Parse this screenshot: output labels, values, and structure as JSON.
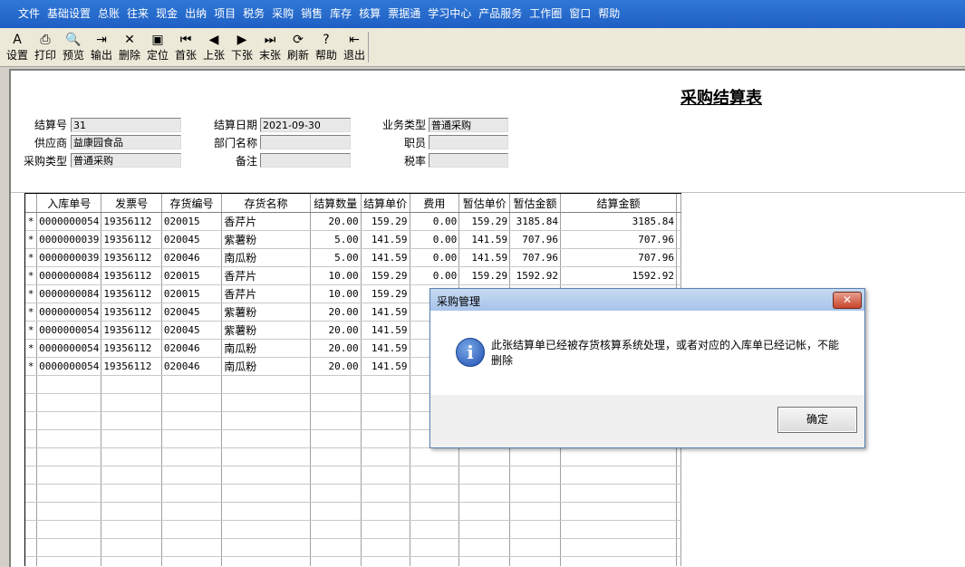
{
  "menu": [
    "文件",
    "基础设置",
    "总账",
    "往来",
    "现金",
    "出纳",
    "项目",
    "税务",
    "采购",
    "销售",
    "库存",
    "核算",
    "票据通",
    "学习中心",
    "产品服务",
    "工作圈",
    "窗口",
    "帮助"
  ],
  "toolbar": [
    {
      "icon": "settings-icon",
      "glyph": "A",
      "label": "设置"
    },
    {
      "icon": "print-icon",
      "glyph": "⎙",
      "label": "打印"
    },
    {
      "icon": "preview-icon",
      "glyph": "🔍",
      "label": "预览"
    },
    {
      "icon": "export-icon",
      "glyph": "⇥",
      "label": "输出"
    },
    {
      "icon": "delete-icon",
      "glyph": "✕",
      "label": "删除"
    },
    {
      "icon": "locate-icon",
      "glyph": "▣",
      "label": "定位"
    },
    {
      "icon": "first-icon",
      "glyph": "⏮",
      "label": "首张"
    },
    {
      "icon": "prev-icon",
      "glyph": "◀",
      "label": "上张"
    },
    {
      "icon": "next-icon",
      "glyph": "▶",
      "label": "下张"
    },
    {
      "icon": "last-icon",
      "glyph": "⏭",
      "label": "末张"
    },
    {
      "icon": "refresh-icon",
      "glyph": "⟳",
      "label": "刷新"
    },
    {
      "icon": "help-icon",
      "glyph": "?",
      "label": "帮助"
    },
    {
      "icon": "exit-icon",
      "glyph": "⇤",
      "label": "退出"
    }
  ],
  "form": {
    "title": "采购结算表",
    "settle_no_label": "结算号",
    "settle_no": "31",
    "settle_date_label": "结算日期",
    "settle_date": "2021-09-30",
    "biz_type_label": "业务类型",
    "biz_type": "普通采购",
    "supplier_label": "供应商",
    "supplier": "益康园食品",
    "dept_label": "部门名称",
    "dept": "",
    "staff_label": "职员",
    "staff": "",
    "purchase_type_label": "采购类型",
    "purchase_type": "普通采购",
    "remark_label": "备注",
    "remark": "",
    "tax_rate_label": "税率",
    "tax_rate": ""
  },
  "grid": {
    "columns": [
      "入库单号",
      "发票号",
      "存货编号",
      "存货名称",
      "结算数量",
      "结算单价",
      "费用",
      "暂估单价",
      "暂估金额",
      "结算金额"
    ],
    "rows": [
      {
        "mark": "*",
        "receipt": "0000000054",
        "invoice": "19356112",
        "code": "020015",
        "name": "香芹片",
        "qty": "20.00",
        "price": "159.29",
        "fee": "0.00",
        "est_price": "159.29",
        "est_amount": "3185.84",
        "amount": "3185.84"
      },
      {
        "mark": "*",
        "receipt": "0000000039",
        "invoice": "19356112",
        "code": "020045",
        "name": "紫薯粉",
        "qty": "5.00",
        "price": "141.59",
        "fee": "0.00",
        "est_price": "141.59",
        "est_amount": "707.96",
        "amount": "707.96"
      },
      {
        "mark": "*",
        "receipt": "0000000039",
        "invoice": "19356112",
        "code": "020046",
        "name": "南瓜粉",
        "qty": "5.00",
        "price": "141.59",
        "fee": "0.00",
        "est_price": "141.59",
        "est_amount": "707.96",
        "amount": "707.96"
      },
      {
        "mark": "*",
        "receipt": "0000000084",
        "invoice": "19356112",
        "code": "020015",
        "name": "香芹片",
        "qty": "10.00",
        "price": "159.29",
        "fee": "0.00",
        "est_price": "159.29",
        "est_amount": "1592.92",
        "amount": "1592.92"
      },
      {
        "mark": "*",
        "receipt": "0000000084",
        "invoice": "19356112",
        "code": "020015",
        "name": "香芹片",
        "qty": "10.00",
        "price": "159.29",
        "fee": "",
        "est_price": "",
        "est_amount": "",
        "amount": ""
      },
      {
        "mark": "*",
        "receipt": "0000000054",
        "invoice": "19356112",
        "code": "020045",
        "name": "紫薯粉",
        "qty": "20.00",
        "price": "141.59",
        "fee": "",
        "est_price": "",
        "est_amount": "",
        "amount": ""
      },
      {
        "mark": "*",
        "receipt": "0000000054",
        "invoice": "19356112",
        "code": "020045",
        "name": "紫薯粉",
        "qty": "20.00",
        "price": "141.59",
        "fee": "",
        "est_price": "",
        "est_amount": "",
        "amount": ""
      },
      {
        "mark": "*",
        "receipt": "0000000054",
        "invoice": "19356112",
        "code": "020046",
        "name": "南瓜粉",
        "qty": "20.00",
        "price": "141.59",
        "fee": "",
        "est_price": "",
        "est_amount": "",
        "amount": ""
      },
      {
        "mark": "*",
        "receipt": "0000000054",
        "invoice": "19356112",
        "code": "020046",
        "name": "南瓜粉",
        "qty": "20.00",
        "price": "141.59",
        "fee": "",
        "est_price": "",
        "est_amount": "",
        "amount": ""
      }
    ]
  },
  "dialog": {
    "title": "采购管理",
    "icon": "info-icon",
    "message": "此张结算单已经被存货核算系统处理，或者对应的入库单已经记帐，不能删除",
    "ok_label": "确定",
    "close_glyph": "✕"
  }
}
